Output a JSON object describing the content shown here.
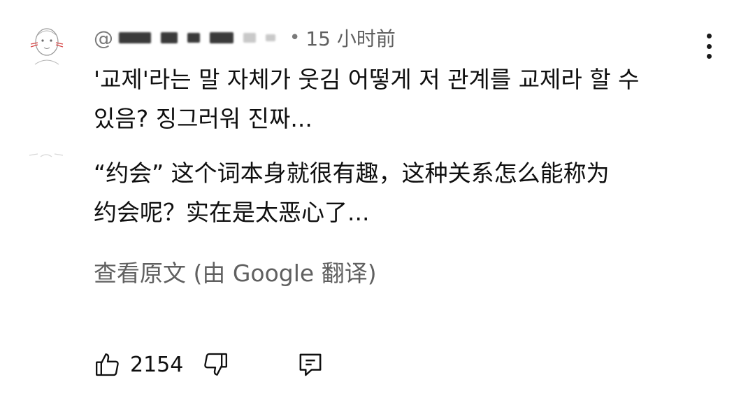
{
  "comment": {
    "author": {
      "handle_prefix": "@",
      "avatar_icon": "sketch-face-avatar-icon"
    },
    "separator": "•",
    "timestamp": "15 小时前",
    "original_text": "'교제'라는 말 자체가 웃김 어떻게 저 관계를 교제라 할 수\n있음? 징그러워 진짜...",
    "translated_text": "“约会” 这个词本身就很有趣，这种关系怎么能称为\n约会呢？实在是太恶心了...",
    "see_original_label": "查看原文 (由 Google 翻译)",
    "actions": {
      "like_count": "2154",
      "like_icon": "thumbs-up-icon",
      "dislike_icon": "thumbs-down-icon",
      "reply_icon": "reply-comment-icon"
    },
    "menu_icon": "more-vertical-icon"
  },
  "colors": {
    "text_primary": "#0f0f0f",
    "text_secondary": "#606060",
    "background": "#ffffff"
  }
}
